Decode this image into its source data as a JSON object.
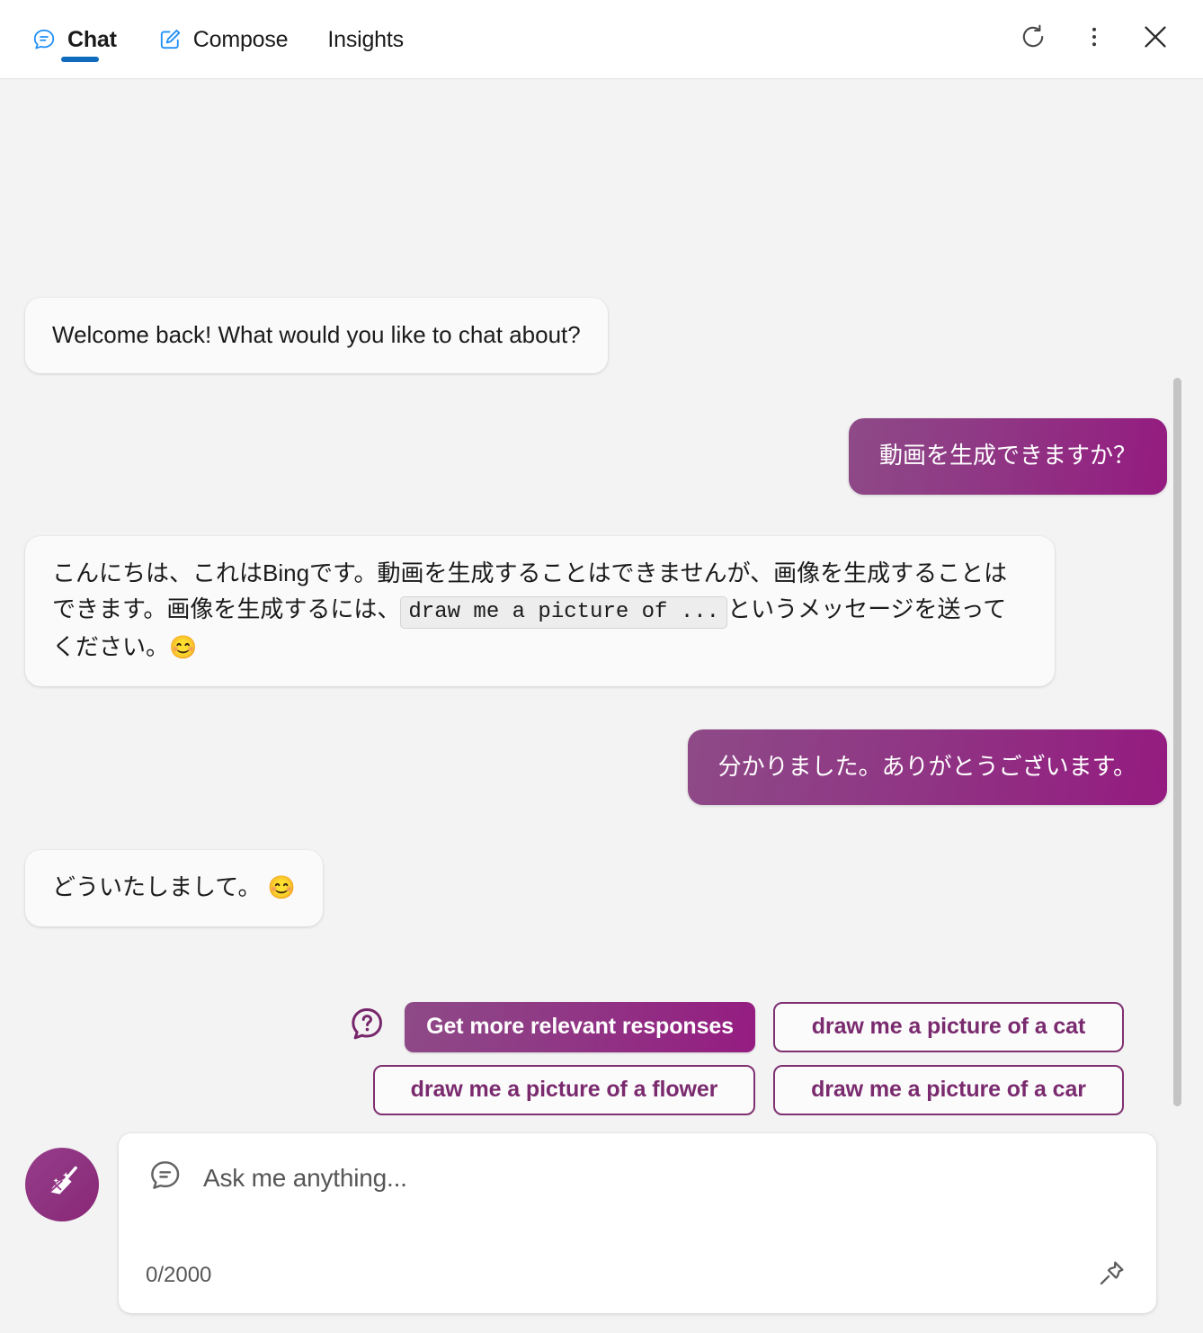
{
  "header": {
    "tabs": [
      {
        "label": "Chat",
        "icon": "chat-bubble-icon",
        "active": true
      },
      {
        "label": "Compose",
        "icon": "compose-pencil-icon",
        "active": false
      },
      {
        "label": "Insights",
        "icon": "none",
        "active": false
      }
    ],
    "actions": [
      {
        "name": "refresh-button",
        "icon": "refresh-icon"
      },
      {
        "name": "more-options-button",
        "icon": "more-vertical-icon"
      },
      {
        "name": "close-button",
        "icon": "close-icon"
      }
    ]
  },
  "conversation": {
    "messages": [
      {
        "role": "bot",
        "text": "Welcome back! What would you like to chat about?"
      },
      {
        "role": "user",
        "text": "動画を生成できますか？"
      },
      {
        "role": "bot",
        "text_part1": "こんにちは、これはBingです。動画を生成することはできませんが、画像を生成することはできます。画像を生成するには、",
        "code": "draw me a picture of ...",
        "text_part2": "というメッセージを送ってください。",
        "emoji": "😊"
      },
      {
        "role": "user",
        "text": "分かりました。ありがとうございます。"
      },
      {
        "role": "bot",
        "text": "どういたしまして。",
        "emoji": "😊"
      }
    ]
  },
  "suggestions": {
    "icon": "question-bubble-icon",
    "primary": "Get more relevant responses",
    "chips": [
      "draw me a picture of a cat",
      "draw me a picture of a flower",
      "draw me a picture of a car"
    ]
  },
  "composer": {
    "new_topic_icon": "broom-sparkle-icon",
    "input_icon": "chat-bubble-icon",
    "placeholder": "Ask me anything...",
    "char_count": "0/2000",
    "pin_icon": "pin-icon"
  },
  "colors": {
    "accent_blue": "#0f6cbd",
    "purple_light": "#8e4a87",
    "purple_dark": "#941b80",
    "chip_border": "#7f3071",
    "chip_text": "#7a2a6e",
    "background": "#f3f3f3"
  }
}
